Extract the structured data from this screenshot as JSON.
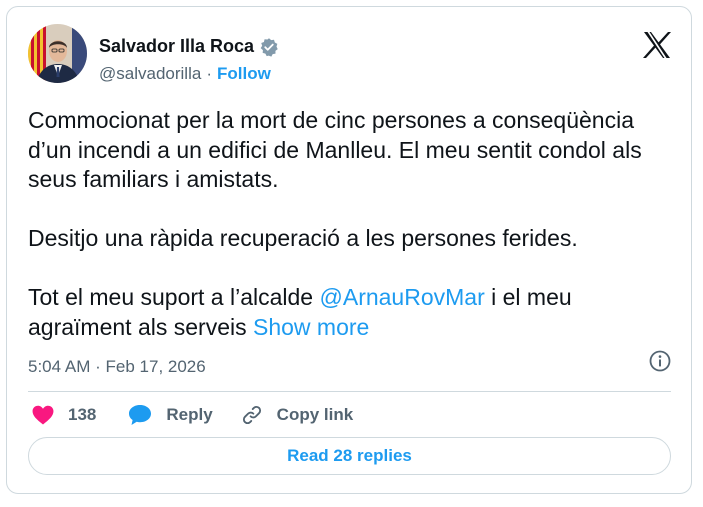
{
  "author": {
    "name": "Salvador Illa Roca",
    "handle": "@salvadorilla",
    "separator": "·",
    "follow_label": "Follow"
  },
  "icons": {
    "avatar": "profile-photo",
    "verified": "verified-badge-icon",
    "brand": "x-logo-icon",
    "info": "info-icon",
    "like": "heart-icon",
    "reply": "speech-bubble-icon",
    "copy_link": "link-icon"
  },
  "colors": {
    "link": "#1d9bf0",
    "heart": "#f91880",
    "secondary_text": "#536471",
    "border": "#cfd9de",
    "verified_badge": "#829aab"
  },
  "tweet": {
    "line1": "Commocionat per la mort de cinc persones a conseqüència d’un incendi a un edifici de Manlleu. El meu sentit condol als seus familiars i amistats.",
    "line2": "Desitjo una ràpida recuperació a les persones ferides.",
    "line3_before": "Tot el meu suport a l’alcalde ",
    "line3_mention": "@ArnauRovMar",
    "line3_after": " i el meu agraïment als serveis ",
    "show_more": "Show more"
  },
  "meta": {
    "time": "5:04 AM",
    "separator": "·",
    "date": "Feb 17, 2026"
  },
  "actions": {
    "likes_count": "138",
    "reply_label": "Reply",
    "copy_link_label": "Copy link"
  },
  "read_replies_label": "Read 28 replies"
}
